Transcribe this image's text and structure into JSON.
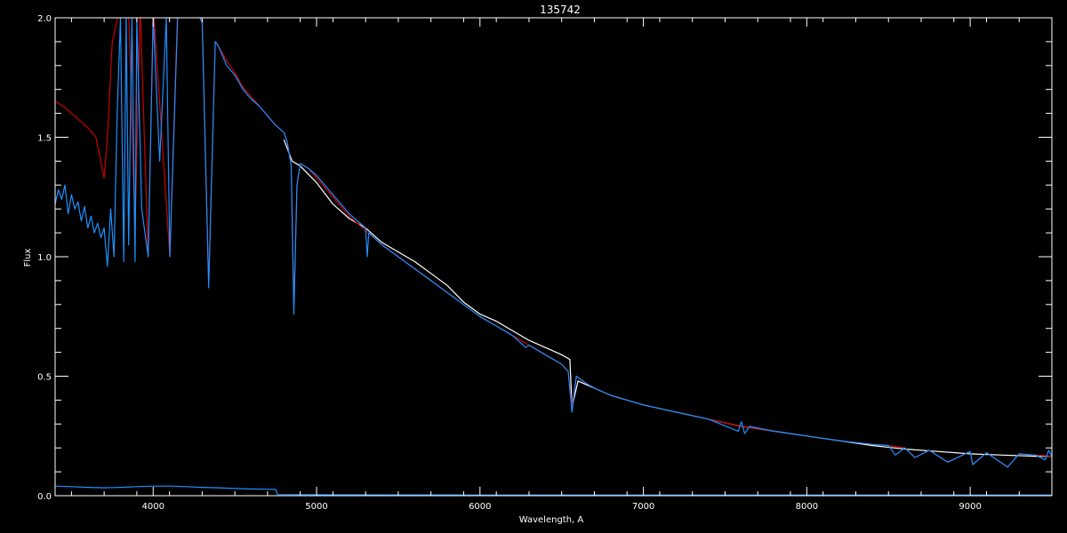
{
  "chart_data": {
    "type": "line",
    "title": "135742",
    "xlabel": "Wavelength, A",
    "ylabel": "Flux",
    "xlim": [
      3400,
      9500
    ],
    "ylim": [
      0.0,
      2.0
    ],
    "xticks": [
      4000,
      5000,
      6000,
      7000,
      8000,
      9000
    ],
    "xtick_labels": [
      "4000",
      "5000",
      "6000",
      "7000",
      "8000",
      "9000"
    ],
    "yticks": [
      0.0,
      0.5,
      1.0,
      1.5,
      2.0
    ],
    "ytick_labels": [
      "0.0",
      "0.5",
      "1.0",
      "1.5",
      "2.0"
    ],
    "background": "#000000",
    "axis_color": "#ffffff",
    "grid": false,
    "legend": "none",
    "series": [
      {
        "color": "#ffffff",
        "x": [
          4800,
          4850,
          4900,
          5000,
          5100,
          5200,
          5300,
          5400,
          5500,
          5600,
          5700,
          5800,
          5900,
          6000,
          6100,
          6200,
          6300,
          6400,
          6500,
          6550,
          6563,
          6600,
          6700,
          6800,
          6900,
          7000,
          7200,
          7400,
          7600,
          7800,
          8000,
          8200,
          8400,
          8600,
          8800,
          9000,
          9200,
          9400,
          9500
        ],
        "y": [
          1.49,
          1.4,
          1.38,
          1.31,
          1.22,
          1.16,
          1.12,
          1.06,
          1.02,
          0.98,
          0.93,
          0.88,
          0.81,
          0.76,
          0.73,
          0.69,
          0.65,
          0.62,
          0.59,
          0.57,
          0.37,
          0.48,
          0.45,
          0.42,
          0.4,
          0.38,
          0.35,
          0.32,
          0.29,
          0.27,
          0.25,
          0.23,
          0.21,
          0.195,
          0.185,
          0.175,
          0.17,
          0.165,
          0.165
        ]
      },
      {
        "color": "#cc0000",
        "x": [
          3400,
          3450,
          3500,
          3550,
          3600,
          3650,
          3700,
          3720,
          3750,
          3800,
          3850,
          3889,
          3920,
          3970,
          4000,
          4102,
          4150,
          4200,
          4250,
          4300,
          4340,
          4380,
          4400,
          4450,
          4500,
          4550,
          4600,
          4650,
          4700,
          4750,
          4800,
          4820,
          4845,
          4861,
          4880,
          4900,
          4950,
          5000,
          5100,
          5200,
          5300,
          5400,
          5500,
          5600,
          5700,
          5800,
          5900,
          6000,
          6100,
          6200,
          6300,
          6400,
          6500,
          6540,
          6563,
          6590,
          6650,
          6700,
          6800,
          6900,
          7000,
          7200,
          7400,
          7600,
          7800,
          8000,
          8200,
          8400,
          8500,
          8600,
          8660,
          8750,
          8862,
          9000,
          9015,
          9100,
          9229,
          9300,
          9400,
          9500
        ],
        "y": [
          1.65,
          1.63,
          1.6,
          1.57,
          1.54,
          1.5,
          1.33,
          1.5,
          1.9,
          2.05,
          2.05,
          1.1,
          2.05,
          1.0,
          2.05,
          1.0,
          2.05,
          2.05,
          2.05,
          2.0,
          0.88,
          1.9,
          1.88,
          1.82,
          1.77,
          1.71,
          1.67,
          1.63,
          1.59,
          1.55,
          1.52,
          1.48,
          1.38,
          0.8,
          1.3,
          1.39,
          1.37,
          1.33,
          1.25,
          1.17,
          1.11,
          1.05,
          1.0,
          0.95,
          0.9,
          0.85,
          0.8,
          0.75,
          0.71,
          0.67,
          0.63,
          0.59,
          0.55,
          0.52,
          0.37,
          0.5,
          0.47,
          0.45,
          0.42,
          0.4,
          0.38,
          0.35,
          0.32,
          0.29,
          0.27,
          0.25,
          0.23,
          0.215,
          0.21,
          0.2,
          0.16,
          0.19,
          0.14,
          0.185,
          0.13,
          0.18,
          0.12,
          0.175,
          0.17,
          0.165
        ]
      },
      {
        "color": "#1e90ff",
        "x": [
          3400,
          3420,
          3440,
          3460,
          3480,
          3500,
          3520,
          3540,
          3560,
          3580,
          3600,
          3620,
          3640,
          3660,
          3680,
          3700,
          3720,
          3740,
          3760,
          3780,
          3800,
          3820,
          3835,
          3850,
          3870,
          3889,
          3900,
          3930,
          3970,
          4000,
          4040,
          4080,
          4102,
          4150,
          4200,
          4250,
          4300,
          4340,
          4380,
          4400,
          4450,
          4500,
          4550,
          4600,
          4650,
          4700,
          4750,
          4800,
          4820,
          4845,
          4861,
          4880,
          4900,
          4950,
          5000,
          5100,
          5200,
          5300,
          5310,
          5320,
          5400,
          5500,
          5600,
          5700,
          5800,
          5900,
          6000,
          6100,
          6200,
          6280,
          6300,
          6400,
          6500,
          6540,
          6563,
          6590,
          6650,
          6700,
          6800,
          6900,
          7000,
          7200,
          7400,
          7580,
          7600,
          7620,
          7650,
          7800,
          8000,
          8200,
          8400,
          8500,
          8542,
          8600,
          8662,
          8750,
          8862,
          9000,
          9015,
          9100,
          9229,
          9300,
          9400,
          9460,
          9480,
          9500
        ],
        "y": [
          1.22,
          1.28,
          1.24,
          1.3,
          1.18,
          1.26,
          1.2,
          1.23,
          1.15,
          1.21,
          1.12,
          1.17,
          1.1,
          1.14,
          1.08,
          1.12,
          0.96,
          1.2,
          1.0,
          1.6,
          2.0,
          0.98,
          2.0,
          1.05,
          2.0,
          0.98,
          2.0,
          1.2,
          1.0,
          2.0,
          1.4,
          2.0,
          1.0,
          2.0,
          2.05,
          2.05,
          1.98,
          0.87,
          1.9,
          1.88,
          1.8,
          1.76,
          1.7,
          1.66,
          1.63,
          1.59,
          1.55,
          1.52,
          1.48,
          1.38,
          0.76,
          1.3,
          1.39,
          1.37,
          1.34,
          1.26,
          1.18,
          1.12,
          1.0,
          1.1,
          1.05,
          1.0,
          0.95,
          0.9,
          0.85,
          0.8,
          0.75,
          0.71,
          0.67,
          0.62,
          0.63,
          0.59,
          0.55,
          0.52,
          0.35,
          0.5,
          0.47,
          0.45,
          0.42,
          0.4,
          0.38,
          0.35,
          0.32,
          0.27,
          0.31,
          0.26,
          0.29,
          0.27,
          0.25,
          0.23,
          0.215,
          0.21,
          0.17,
          0.2,
          0.16,
          0.19,
          0.14,
          0.185,
          0.13,
          0.18,
          0.12,
          0.175,
          0.17,
          0.15,
          0.19,
          0.165
        ]
      },
      {
        "color": "#1e90ff",
        "x": [
          3400,
          3500,
          3600,
          3700,
          3800,
          3900,
          4000,
          4100,
          4200,
          4300,
          4400,
          4500,
          4600,
          4700,
          4750,
          4760,
          5000,
          6000,
          7000,
          8000,
          9000,
          9500
        ],
        "y": [
          0.04,
          0.038,
          0.035,
          0.033,
          0.035,
          0.038,
          0.04,
          0.04,
          0.038,
          0.035,
          0.033,
          0.03,
          0.028,
          0.027,
          0.026,
          0.005,
          0.004,
          0.003,
          0.003,
          0.003,
          0.003,
          0.003
        ]
      }
    ]
  }
}
